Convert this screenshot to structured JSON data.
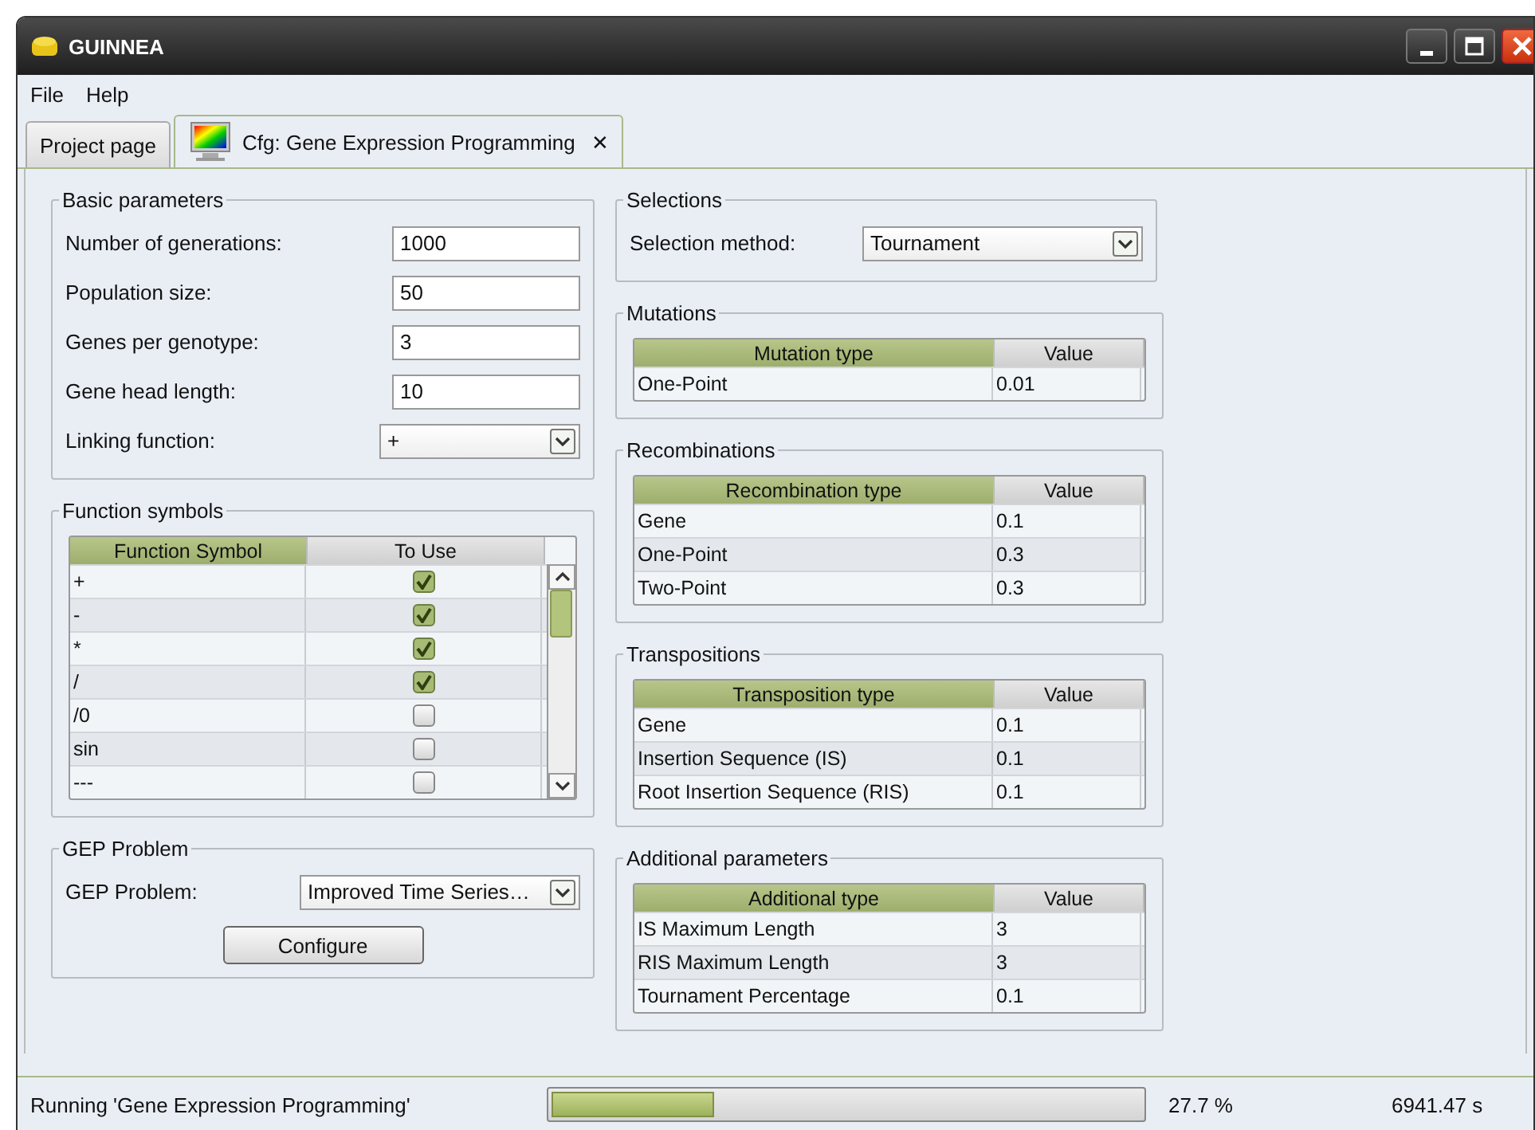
{
  "window": {
    "title": "GUINNEA"
  },
  "menu": [
    "File",
    "Help"
  ],
  "tabs": [
    {
      "label": "Project page",
      "selected": false
    },
    {
      "label": "Cfg: Gene Expression Programming",
      "selected": true,
      "close_glyph": "✕"
    }
  ],
  "basic_parameters": {
    "title": "Basic parameters",
    "fields": [
      {
        "label": "Number of generations:",
        "value": "1000",
        "kind": "text"
      },
      {
        "label": "Population size:",
        "value": "50",
        "kind": "text"
      },
      {
        "label": "Genes per genotype:",
        "value": "3",
        "kind": "text"
      },
      {
        "label": "Gene head length:",
        "value": "10",
        "kind": "text"
      },
      {
        "label": "Linking function:",
        "value": "+",
        "kind": "dropdown"
      }
    ]
  },
  "function_symbols": {
    "title": "Function symbols",
    "columns": [
      "Function Symbol",
      "To Use"
    ],
    "rows": [
      {
        "symbol": "+",
        "checked": true
      },
      {
        "symbol": "-",
        "checked": true
      },
      {
        "symbol": "*",
        "checked": true
      },
      {
        "symbol": "/",
        "checked": true
      },
      {
        "symbol": "/0",
        "checked": false
      },
      {
        "symbol": "sin",
        "checked": false
      },
      {
        "symbol": "---",
        "checked": false
      }
    ]
  },
  "gep_problem": {
    "title": "GEP Problem",
    "label": "GEP Problem:",
    "value": "Improved Time Series…",
    "button": "Configure"
  },
  "selections": {
    "title": "Selections",
    "label": "Selection method:",
    "value": "Tournament"
  },
  "tables": [
    {
      "title": "Mutations",
      "columns": [
        "Mutation type",
        "Value"
      ],
      "rows": [
        {
          "type": "One-Point",
          "value": "0.01"
        }
      ]
    },
    {
      "title": "Recombinations",
      "columns": [
        "Recombination type",
        "Value"
      ],
      "rows": [
        {
          "type": "Gene",
          "value": "0.1"
        },
        {
          "type": "One-Point",
          "value": "0.3"
        },
        {
          "type": "Two-Point",
          "value": "0.3"
        }
      ]
    },
    {
      "title": "Transpositions",
      "columns": [
        "Transposition type",
        "Value"
      ],
      "rows": [
        {
          "type": "Gene",
          "value": "0.1"
        },
        {
          "type": "Insertion Sequence (IS)",
          "value": "0.1"
        },
        {
          "type": "Root Insertion Sequence (RIS)",
          "value": "0.1"
        }
      ]
    },
    {
      "title": "Additional parameters",
      "columns": [
        "Additional type",
        "Value"
      ],
      "rows": [
        {
          "type": "IS Maximum Length",
          "value": "3"
        },
        {
          "type": "RIS Maximum Length",
          "value": "3"
        },
        {
          "type": "Tournament Percentage",
          "value": "0.1"
        }
      ]
    }
  ],
  "status_bar": {
    "text": "Running 'Gene Expression Programming'",
    "level": 0.277,
    "percent": "27.7 %",
    "time": "6941.47 s"
  }
}
